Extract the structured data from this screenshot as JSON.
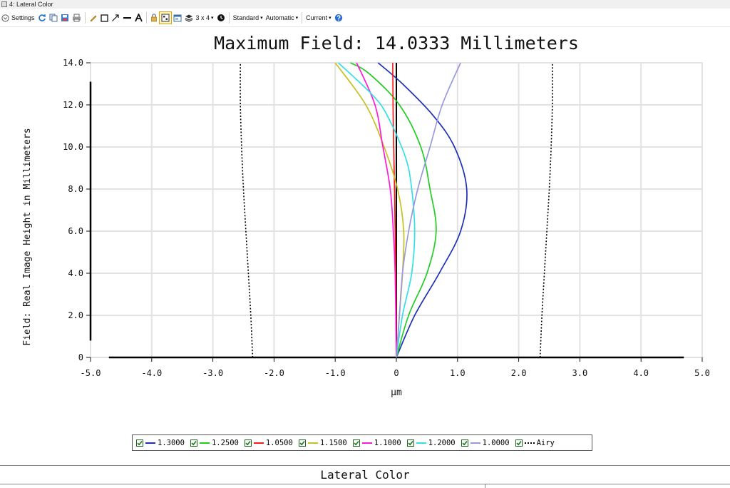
{
  "window": {
    "title": "4: Lateral Color"
  },
  "toolbar": {
    "settings_label": "Settings",
    "layout_label": "3 x 4",
    "standard_label": "Standard",
    "automatic_label": "Automatic",
    "current_label": "Current"
  },
  "footer": {
    "title": "Lateral Color"
  },
  "chart_data": {
    "type": "line",
    "title": "Maximum Field: 14.0333 Millimeters",
    "xlabel": "µm",
    "ylabel": "Field: Real Image Height in Millimeters",
    "xlim": [
      -5.0,
      5.0
    ],
    "ylim": [
      0,
      14.0
    ],
    "x_ticks": [
      "-5.0",
      "-4.0",
      "-3.0",
      "-2.0",
      "-1.0",
      "0",
      "1.0",
      "2.0",
      "3.0",
      "4.0",
      "5.0"
    ],
    "y_ticks": [
      "0",
      "2.0",
      "4.0",
      "6.0",
      "8.0",
      "10.0",
      "12.0",
      "14.0"
    ],
    "grid": true,
    "legend_position": "bottom",
    "series": [
      {
        "name": "1.3000",
        "color": "#1e2fb8",
        "dash": "solid",
        "points": [
          [
            0,
            0
          ],
          [
            0.3,
            2
          ],
          [
            0.7,
            4
          ],
          [
            1.05,
            6
          ],
          [
            1.15,
            8
          ],
          [
            0.95,
            10
          ],
          [
            0.6,
            11.5
          ],
          [
            0.1,
            13
          ],
          [
            -0.3,
            14
          ]
        ]
      },
      {
        "name": "1.2500",
        "color": "#22cc22",
        "dash": "solid",
        "points": [
          [
            0,
            0
          ],
          [
            0.2,
            2
          ],
          [
            0.5,
            4
          ],
          [
            0.65,
            6
          ],
          [
            0.55,
            8
          ],
          [
            0.4,
            10
          ],
          [
            0.05,
            12
          ],
          [
            -0.45,
            13.5
          ],
          [
            -0.75,
            14
          ]
        ]
      },
      {
        "name": "1.0500",
        "color": "#ff1a1a",
        "dash": "solid",
        "points": [
          [
            0,
            0
          ],
          [
            -0.01,
            4
          ],
          [
            -0.03,
            8
          ],
          [
            -0.05,
            11
          ],
          [
            -0.06,
            14
          ]
        ]
      },
      {
        "name": "1.1500",
        "color": "#c8c020",
        "dash": "solid",
        "points": [
          [
            0,
            0
          ],
          [
            0.05,
            2
          ],
          [
            0.1,
            4
          ],
          [
            0.12,
            6
          ],
          [
            0.02,
            8
          ],
          [
            -0.2,
            10
          ],
          [
            -0.5,
            12
          ],
          [
            -1.0,
            14
          ]
        ]
      },
      {
        "name": "1.1000",
        "color": "#ff1ad9",
        "dash": "solid",
        "points": [
          [
            0,
            0
          ],
          [
            -0.02,
            4
          ],
          [
            -0.05,
            6
          ],
          [
            -0.1,
            8
          ],
          [
            -0.22,
            10
          ],
          [
            -0.35,
            12
          ],
          [
            -0.65,
            14
          ]
        ]
      },
      {
        "name": "1.2000",
        "color": "#33e0e8",
        "dash": "solid",
        "points": [
          [
            0,
            0
          ],
          [
            0.1,
            2
          ],
          [
            0.25,
            4
          ],
          [
            0.3,
            6
          ],
          [
            0.25,
            8
          ],
          [
            0.15,
            9.5
          ],
          [
            -0.15,
            11.5
          ],
          [
            -0.4,
            12.5
          ],
          [
            -0.95,
            14
          ]
        ]
      },
      {
        "name": "1.0000",
        "color": "#9999e0",
        "dash": "solid",
        "points": [
          [
            0,
            0
          ],
          [
            0.05,
            2
          ],
          [
            0.1,
            4
          ],
          [
            0.2,
            6
          ],
          [
            0.35,
            8
          ],
          [
            0.55,
            10
          ],
          [
            0.75,
            12
          ],
          [
            1.05,
            14
          ]
        ]
      },
      {
        "name": "Airy",
        "color": "#000000",
        "dash": "dotted",
        "points": [
          [
            2.35,
            0
          ],
          [
            2.38,
            2
          ],
          [
            2.42,
            4
          ],
          [
            2.46,
            6
          ],
          [
            2.5,
            8
          ],
          [
            2.53,
            10
          ],
          [
            2.55,
            12
          ],
          [
            2.55,
            14
          ]
        ],
        "mirror": true
      }
    ]
  }
}
